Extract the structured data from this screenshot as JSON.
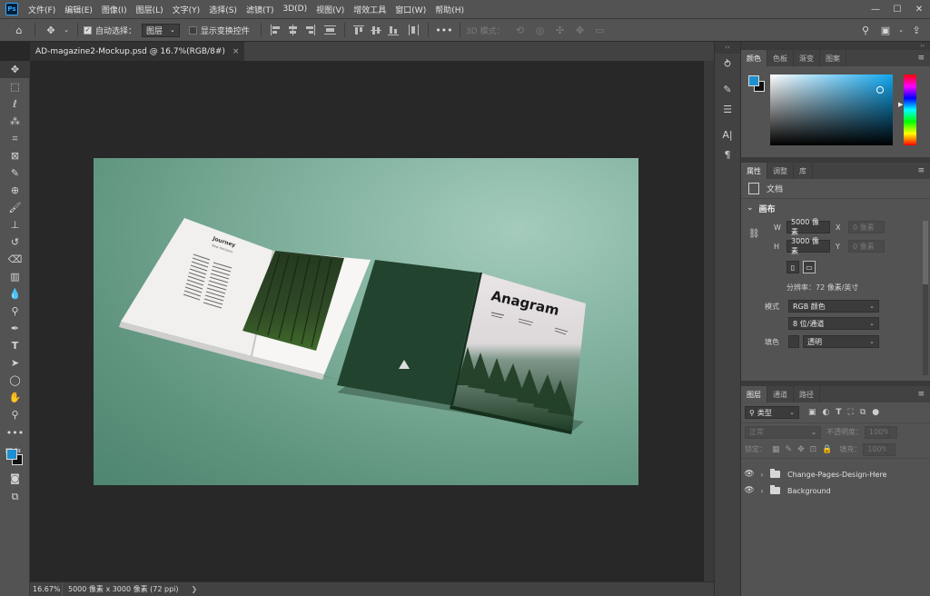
{
  "app": {
    "logo": "Ps"
  },
  "menu": [
    "文件(F)",
    "编辑(E)",
    "图像(I)",
    "图层(L)",
    "文字(Y)",
    "选择(S)",
    "滤镜(T)",
    "3D(D)",
    "视图(V)",
    "增效工具",
    "窗口(W)",
    "帮助(H)"
  ],
  "window_controls": {
    "minimize": "—",
    "maximize": "☐",
    "close": "✕"
  },
  "options": {
    "auto_select_label": "自动选择：",
    "auto_select_value": "图层",
    "show_transform_label": "显示变换控件",
    "mode_3d_label": "3D 模式："
  },
  "tab": {
    "title": "AD-magazine2-Mockup.psd @ 16.7%(RGB/8#)",
    "close": "×"
  },
  "mockup": {
    "spread_title": "Journey",
    "spread_subtitle": "New Horizons",
    "cover_title": "Anagram"
  },
  "status": {
    "zoom": "16.67%",
    "doc_info": "5000 像素 x 3000 像素 (72 ppi)",
    "arrow": "❯"
  },
  "color_panel": {
    "tabs": [
      "颜色",
      "色板",
      "渐变",
      "图案"
    ],
    "fg_color": "#1e8fd0",
    "bg_color": "#111111"
  },
  "properties_panel": {
    "tabs": [
      "属性",
      "调整",
      "库"
    ],
    "doc_label": "文档",
    "section": "画布",
    "w_label": "W",
    "w_value": "5000 像素",
    "x_label": "X",
    "x_placeholder": "0 像素",
    "h_label": "H",
    "h_value": "3000 像素",
    "y_label": "Y",
    "y_placeholder": "0 像素",
    "resolution": "分辨率：72 像素/英寸",
    "mode_label": "模式",
    "mode_value": "RGB 颜色",
    "depth_value": "8 位/通道",
    "fill_label": "填色",
    "fill_value": "透明"
  },
  "layers_panel": {
    "tabs": [
      "图层",
      "通道",
      "路径"
    ],
    "filter_label": "类型",
    "blend_mode": "正常",
    "opacity_label": "不透明度：",
    "opacity_value": "100%",
    "lock_label": "锁定：",
    "fill_label": "填充：",
    "fill_value": "100%",
    "layers": [
      {
        "name": "Change-Pages-Design-Here"
      },
      {
        "name": "Background"
      }
    ]
  }
}
